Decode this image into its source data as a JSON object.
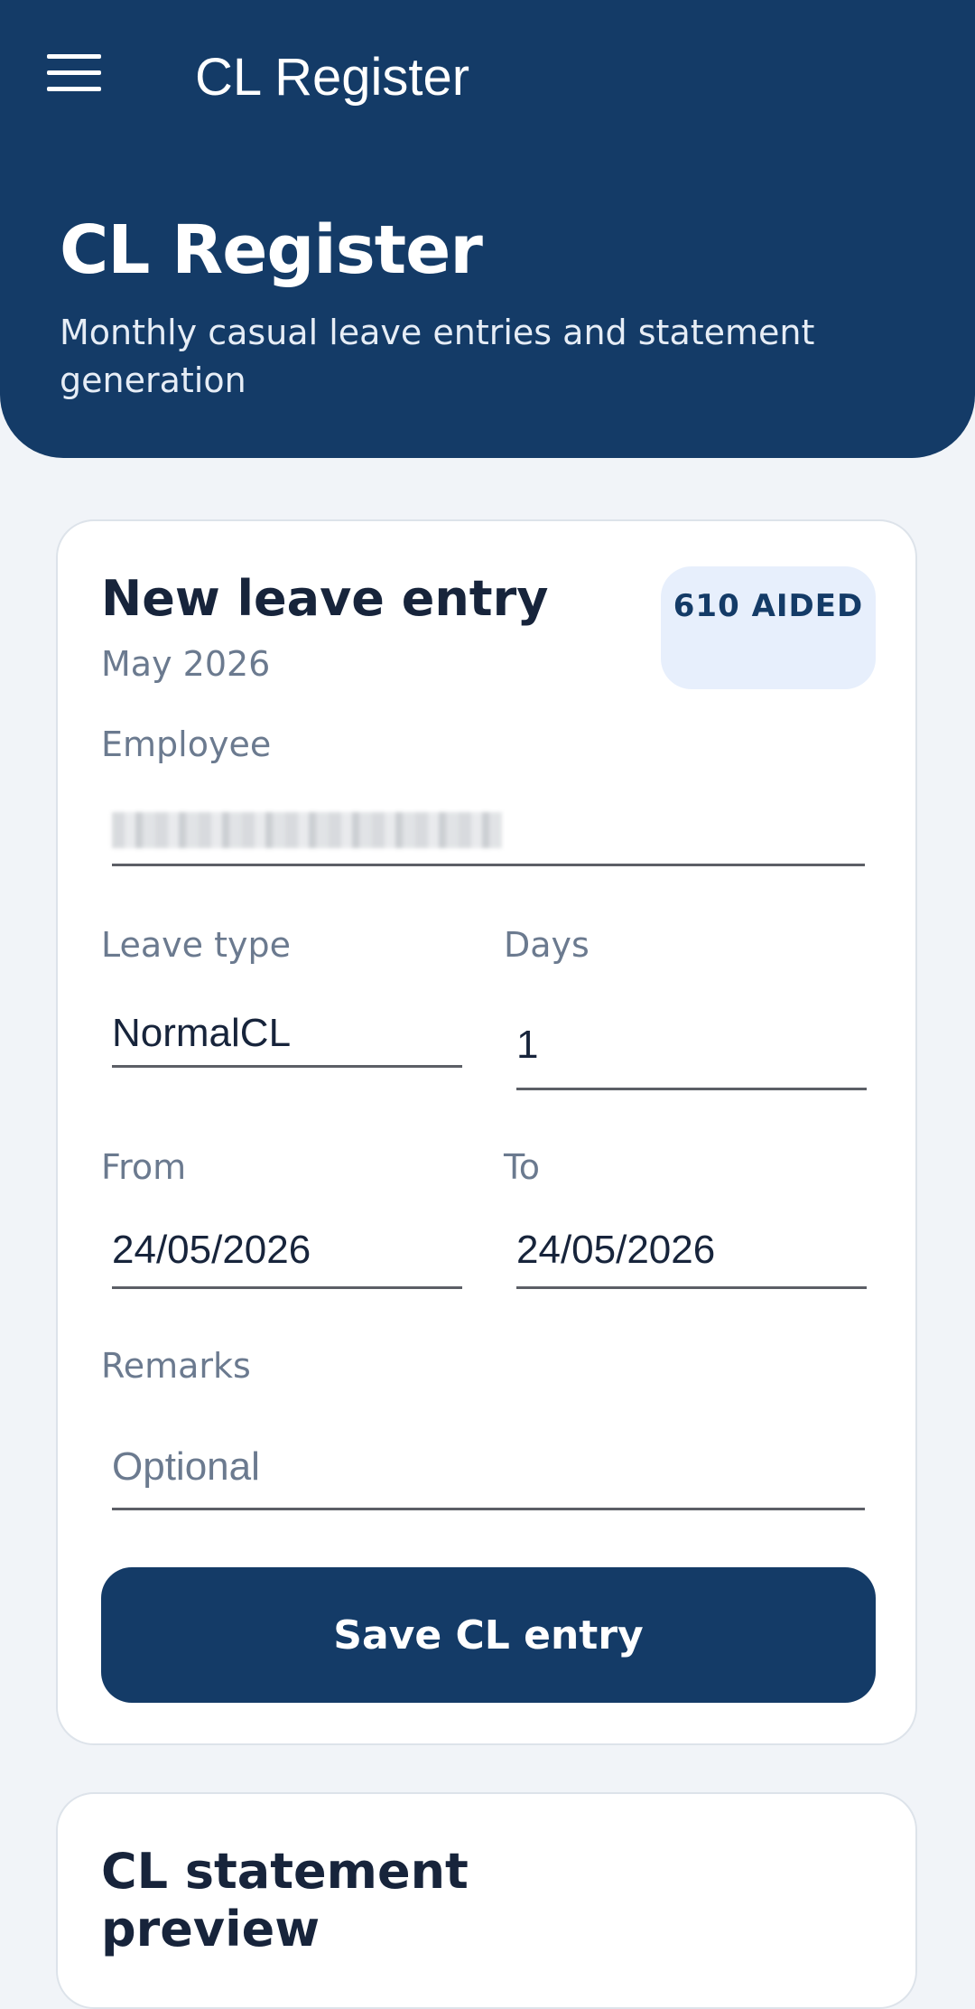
{
  "appbar": {
    "title": "CL Register",
    "menu_icon": "hamburger-menu-icon"
  },
  "hero": {
    "title": "CL Register",
    "subtitle": "Monthly casual leave entries and statement generation"
  },
  "entry_card": {
    "title": "New leave entry",
    "month": "May 2026",
    "badge": "610 AIDED",
    "employee": {
      "label": "Employee",
      "value": ""
    },
    "leave_type": {
      "label": "Leave type",
      "value": "NormalCL"
    },
    "days": {
      "label": "Days",
      "value": "1"
    },
    "from": {
      "label": "From",
      "value": "24/05/2026"
    },
    "to": {
      "label": "To",
      "value": "24/05/2026"
    },
    "remarks": {
      "label": "Remarks",
      "placeholder": "Optional",
      "value": ""
    },
    "save_label": "Save CL entry"
  },
  "preview_card": {
    "title": "CL statement preview"
  },
  "colors": {
    "primary": "#143b67",
    "background": "#f1f4f8",
    "badge_bg": "#e7effc"
  }
}
